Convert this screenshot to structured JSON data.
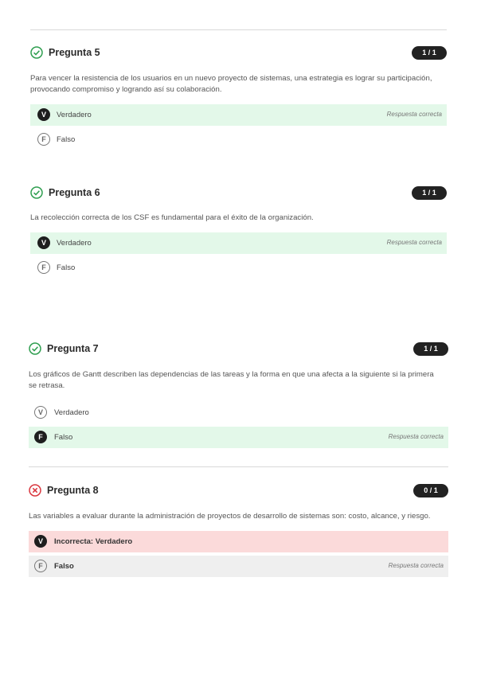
{
  "questions": [
    {
      "title": "Pregunta 5",
      "status": "correct",
      "score": "1 / 1",
      "text": "Para vencer la resistencia de los usuarios en un nuevo proyecto de sistemas, una estrategia es lograr su participación, provocando compromiso y logrando así su colaboración.",
      "options": [
        {
          "letter": "V",
          "label": "Verdadero",
          "note": "Respuesta correcta"
        },
        {
          "letter": "F",
          "label": "Falso",
          "note": ""
        }
      ]
    },
    {
      "title": "Pregunta 6",
      "status": "correct",
      "score": "1 / 1",
      "text": "La recolección correcta de los CSF es fundamental para el éxito de la organización.",
      "options": [
        {
          "letter": "V",
          "label": "Verdadero",
          "note": "Respuesta correcta"
        },
        {
          "letter": "F",
          "label": "Falso",
          "note": ""
        }
      ]
    },
    {
      "title": "Pregunta 7",
      "status": "correct",
      "score": "1 / 1",
      "text": "Los gráficos de Gantt describen las dependencias de las tareas y la forma en que una afecta a la siguiente si la primera se retrasa.",
      "options": [
        {
          "letter": "V",
          "label": "Verdadero",
          "note": ""
        },
        {
          "letter": "F",
          "label": "Falso",
          "note": "Respuesta correcta"
        }
      ]
    },
    {
      "title": "Pregunta 8",
      "status": "incorrect",
      "score": "0 / 1",
      "text": "Las variables a evaluar durante la administración de proyectos de desarrollo de sistemas son: costo, alcance, y riesgo.",
      "options": [
        {
          "letter": "V",
          "label": "Incorrecta: Verdadero",
          "note": ""
        },
        {
          "letter": "F",
          "label": "Falso",
          "note": "Respuesta correcta"
        }
      ]
    }
  ],
  "colors": {
    "correct_icon": "#2e9e4f",
    "incorrect_icon": "#d9363e",
    "correct_bg": "#e3f8e9",
    "incorrect_bg": "#fbdada",
    "neutral_bg": "#efefef"
  }
}
